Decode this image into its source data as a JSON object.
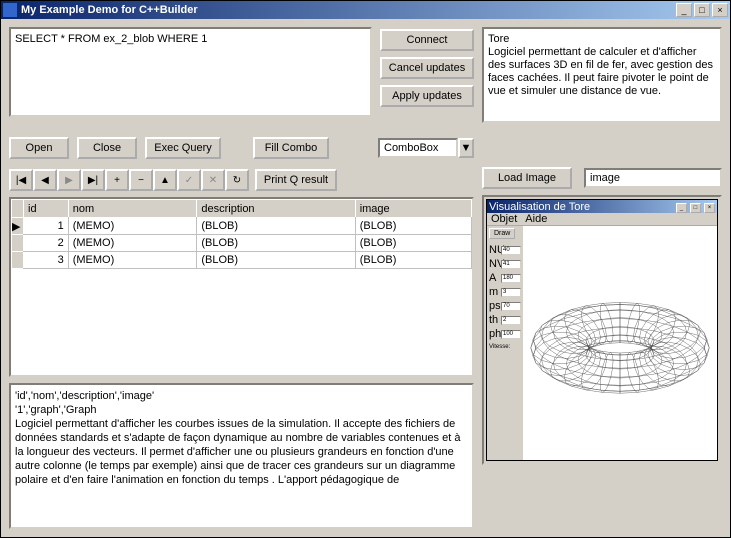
{
  "window": {
    "title": "My Example Demo for C++Builder"
  },
  "sql": "SELECT * FROM ex_2_blob WHERE 1",
  "buttons": {
    "connect": "Connect",
    "cancel_updates": "Cancel updates",
    "apply_updates": "Apply updates",
    "open": "Open",
    "close": "Close",
    "exec_query": "Exec Query",
    "fill_combo": "Fill Combo",
    "print_q": "Print Q result",
    "load_image": "Load Image"
  },
  "combo": {
    "value": "ComboBox"
  },
  "grid": {
    "headers": [
      "id",
      "nom",
      "description",
      "image"
    ],
    "rows": [
      {
        "id": "1",
        "nom": "(MEMO)",
        "description": "(BLOB)",
        "image": "(BLOB)"
      },
      {
        "id": "2",
        "nom": "(MEMO)",
        "description": "(BLOB)",
        "image": "(BLOB)"
      },
      {
        "id": "3",
        "nom": "(MEMO)",
        "description": "(BLOB)",
        "image": "(BLOB)"
      }
    ]
  },
  "memo": {
    "line1": "'id','nom','description','image'",
    "line2": "",
    "line3": "'1','graph','Graph",
    "line4": "Logiciel  permettant d'afficher les courbes issues de la simulation. Il accepte des fichiers de données standards et s'adapte de façon dynamique au nombre de variables contenues et à la longueur des vecteurs. Il permet d'afficher une ou plusieurs grandeurs en fonction d'une autre colonne (le temps par exemple) ainsi que de tracer ces grandeurs sur un diagramme polaire et d'en faire l'animation en fonction du temps . L'apport pédagogique de"
  },
  "description": "Tore\nLogiciel permettant de calculer et d'afficher des surfaces 3D en fil de fer, avec gestion des faces cachées. Il peut faire pivoter le point de vue et simuler une distance de vue.",
  "image_field": "image",
  "inner": {
    "title": "Visualisation de Tore",
    "menu": {
      "objet": "Objet",
      "aide": "Aide"
    },
    "draw": "Draw",
    "params": {
      "NU": {
        "label": "NU",
        "value": "40"
      },
      "NV": {
        "label": "NV",
        "value": "41"
      },
      "A": {
        "label": "A",
        "value": "180"
      },
      "m": {
        "label": "m",
        "value": "3"
      },
      "ps": {
        "label": "ps",
        "value": "70"
      },
      "th": {
        "label": "th",
        "value": "2"
      },
      "ph": {
        "label": "ph",
        "value": "100"
      }
    },
    "vitesse": "Vitesse:"
  }
}
